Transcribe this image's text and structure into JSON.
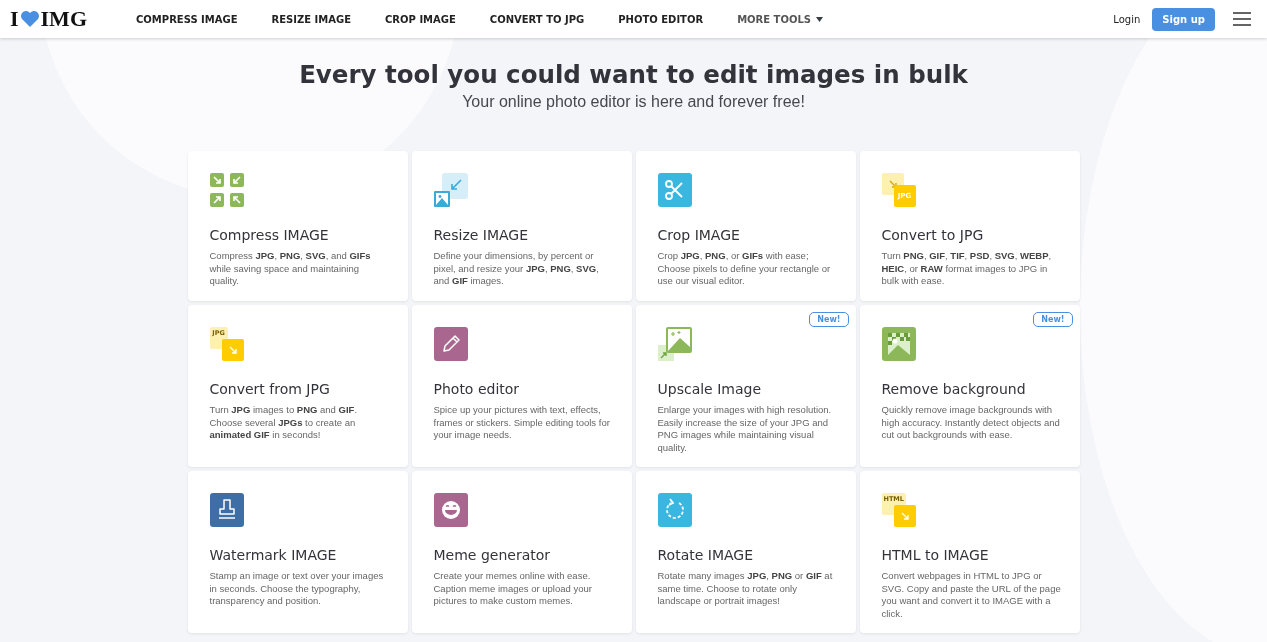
{
  "nav": {
    "logo": {
      "left": "I",
      "right": "IMG"
    },
    "links": [
      {
        "label": "COMPRESS IMAGE",
        "dropdown": false
      },
      {
        "label": "RESIZE IMAGE",
        "dropdown": false
      },
      {
        "label": "CROP IMAGE",
        "dropdown": false
      },
      {
        "label": "CONVERT TO JPG",
        "dropdown": false
      },
      {
        "label": "PHOTO EDITOR",
        "dropdown": false
      },
      {
        "label": "MORE TOOLS",
        "dropdown": true
      }
    ],
    "login": "Login",
    "signup": "Sign up"
  },
  "hero": {
    "title": "Every tool you could want to edit images in bulk",
    "subtitle": "Your online photo editor is here and forever free!"
  },
  "tools": [
    {
      "kind": "compress",
      "title": "Compress IMAGE",
      "description": "Compress **JPG**, **PNG**, **SVG**, and **GIFs** while saving space and maintaining quality."
    },
    {
      "kind": "resize",
      "title": "Resize IMAGE",
      "description": "Define your dimensions, by percent or pixel, and resize your **JPG**, **PNG**, **SVG**, and **GIF** images."
    },
    {
      "kind": "crop",
      "title": "Crop IMAGE",
      "description": "Crop **JPG**, **PNG**, or **GIFs** with ease; Choose pixels to define your rectangle or use our visual editor."
    },
    {
      "kind": "convert_to",
      "icon_label": "JPG",
      "title": "Convert to JPG",
      "description": "Turn **PNG**, **GIF**, **TIF**, **PSD**, **SVG**, **WEBP**, **HEIC**, or **RAW** format images to JPG in bulk with ease."
    },
    {
      "kind": "convert_from",
      "icon_label": "JPG",
      "title": "Convert from JPG",
      "description": "Turn **JPG** images to **PNG** and **GIF**. Choose several **JPGs** to create an **animated GIF** in seconds!"
    },
    {
      "kind": "editor",
      "title": "Photo editor",
      "description": "Spice up your pictures with text, effects, frames or stickers. Simple editing tools for your image needs."
    },
    {
      "kind": "upscale",
      "badge": "New!",
      "title": "Upscale Image",
      "description": "Enlarge your images with high resolution. Easily increase the size of your JPG and PNG images while maintaining visual quality."
    },
    {
      "kind": "remove_bg",
      "badge": "New!",
      "title": "Remove background",
      "description": "Quickly remove image backgrounds with high accuracy. Instantly detect objects and cut out backgrounds with ease."
    },
    {
      "kind": "watermark",
      "title": "Watermark IMAGE",
      "description": "Stamp an image or text over your images in seconds. Choose the typography, transparency and position."
    },
    {
      "kind": "meme",
      "title": "Meme generator",
      "description": "Create your memes online with ease. Caption meme images or upload your pictures to make custom memes."
    },
    {
      "kind": "rotate",
      "title": "Rotate IMAGE",
      "description": "Rotate many images **JPG**, **PNG** or **GIF** at same time. Choose to rotate only landscape or portrait images!"
    },
    {
      "kind": "html",
      "icon_label": "HTML",
      "title": "HTML to IMAGE",
      "description": "Convert webpages in HTML to JPG or SVG. Copy and paste the URL of the page you want and convert it to IMAGE with a click."
    }
  ]
}
